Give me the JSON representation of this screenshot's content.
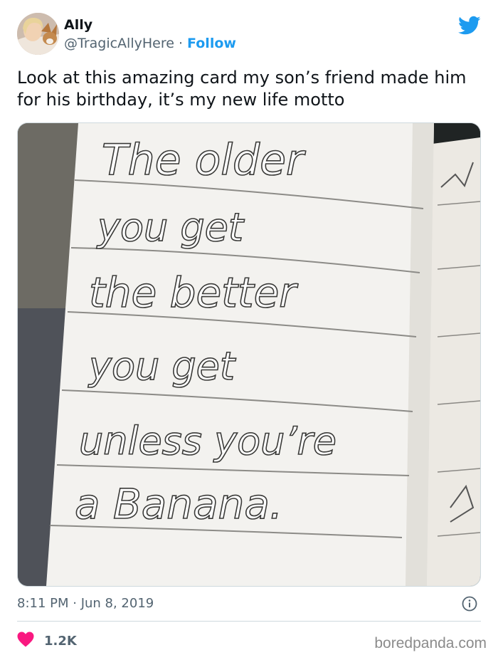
{
  "tweet": {
    "author_name": "Ally",
    "author_handle": "@TragicAllyHere",
    "separator": " · ",
    "follow_label": "Follow",
    "text": "Look at this amazing card my son’s friend made him for his birthday, it’s my new life motto",
    "timestamp": "8:11 PM · Jun 8, 2019",
    "like_count": "1.2K"
  },
  "card": {
    "lines": [
      "The older",
      "you get",
      "the better",
      "you get",
      "unless you’re",
      "a Banana."
    ]
  },
  "watermark": "boredpanda.com",
  "icons": {
    "brand": "twitter-bird-icon",
    "info": "info-icon",
    "like": "heart-icon"
  },
  "colors": {
    "accent": "#1d9bf0",
    "like": "#f91880",
    "secondary_text": "#536471"
  }
}
